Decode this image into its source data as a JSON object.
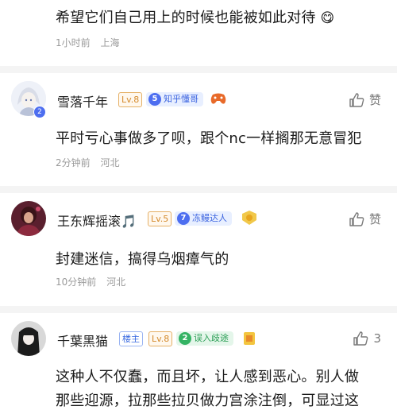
{
  "comments": [
    {
      "text": "希望它们自己用上的时候也能被如此对待",
      "time": "1小时前",
      "location": "上海",
      "emoji": "😋"
    },
    {
      "user": "雪落千年",
      "level": "Lv.8",
      "badge_num": "5",
      "badge_text": "知乎懂哥",
      "text": "平时亏心事做多了呗，跟个nc一样搁那无意冒犯",
      "time": "2分钟前",
      "location": "河北",
      "like_label": "赞",
      "avatar_badge": "2"
    },
    {
      "user": "王东辉摇滚🎵",
      "level": "Lv.5",
      "badge_num": "7",
      "badge_text": "冻鳗达人",
      "text": "封建迷信，搞得乌烟瘴气的",
      "time": "10分钟前",
      "location": "河北",
      "like_label": "赞"
    },
    {
      "user": "千葉黑猫",
      "op_tag": "楼主",
      "level": "Lv.8",
      "badge_num": "2",
      "badge_text": "误入歧途",
      "text": "这种人不仅蠢，而且坏，让人感到恶心。别人做",
      "text_line2": "那些迎源，拉那些拉贝做力宫涂注倒，可显过这",
      "like_count": "3"
    }
  ],
  "colors": {
    "blue_badge": "#4d6ef0",
    "green_badge": "#34b363",
    "level": "#d48a2c",
    "meta": "#9a9a9a"
  }
}
